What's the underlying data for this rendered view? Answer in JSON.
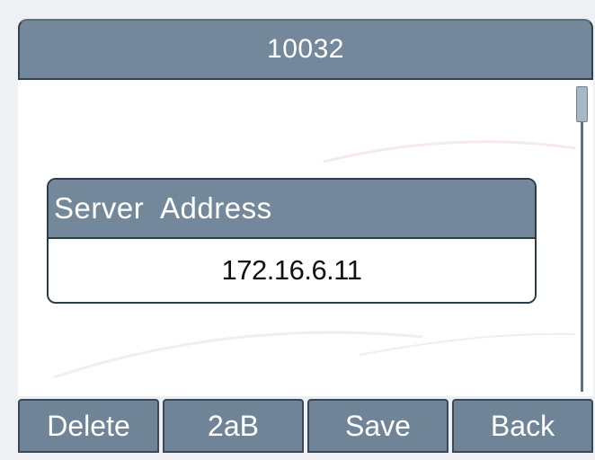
{
  "header": {
    "title": "10032"
  },
  "field": {
    "label": "Server  Address",
    "value": "172.16.6.11"
  },
  "softkeys": [
    {
      "label": "Delete"
    },
    {
      "label": "2aB"
    },
    {
      "label": "Save"
    },
    {
      "label": "Back"
    }
  ],
  "colors": {
    "bar": "#73899b",
    "content_bg": "#ffffff",
    "outer_bg": "#eef0f3",
    "text_light": "#ffffff",
    "text_dark": "#101010"
  }
}
